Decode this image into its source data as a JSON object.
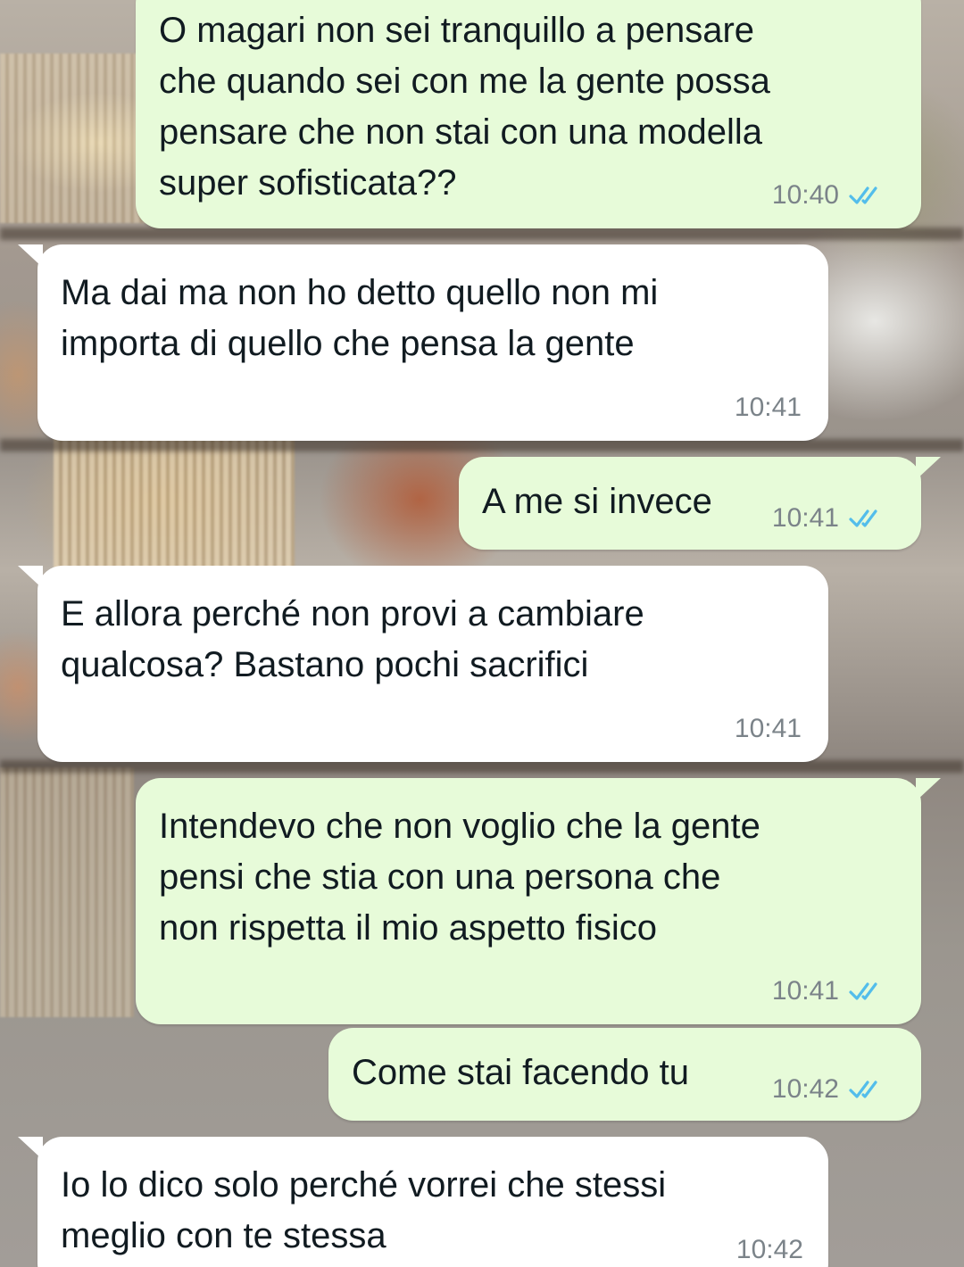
{
  "messages": [
    {
      "direction": "out",
      "text": "O magari non sei tranquillo a pensare\nche quando sei con me la gente possa\npensare che non stai con una modella\nsuper sofisticata??",
      "time": "10:40",
      "status": "read"
    },
    {
      "direction": "in",
      "text": "Ma dai ma non ho detto quello non mi\nimporta di quello che pensa la gente",
      "time": "10:41"
    },
    {
      "direction": "out",
      "text": "A me si invece",
      "time": "10:41",
      "status": "read"
    },
    {
      "direction": "in",
      "text": "E allora perché non provi a cambiare\nqualcosa? Bastano pochi sacrifici",
      "time": "10:41"
    },
    {
      "direction": "out",
      "text": "Intendevo che non voglio che la gente\npensi che stia con una persona che\nnon rispetta il mio aspetto fisico",
      "time": "10:41",
      "status": "read"
    },
    {
      "direction": "out",
      "text": "Come stai facendo tu",
      "time": "10:42",
      "status": "read"
    },
    {
      "direction": "in",
      "text": "Io lo dico solo perché vorrei che stessi\nmeglio con te stessa",
      "time": "10:42"
    }
  ],
  "colors": {
    "outgoing_bubble": "#e7fbd9",
    "incoming_bubble": "#ffffff",
    "read_ticks": "#53bdeb",
    "timestamp": "#7b8389"
  },
  "icons": {
    "read_status": "double-check-icon"
  }
}
